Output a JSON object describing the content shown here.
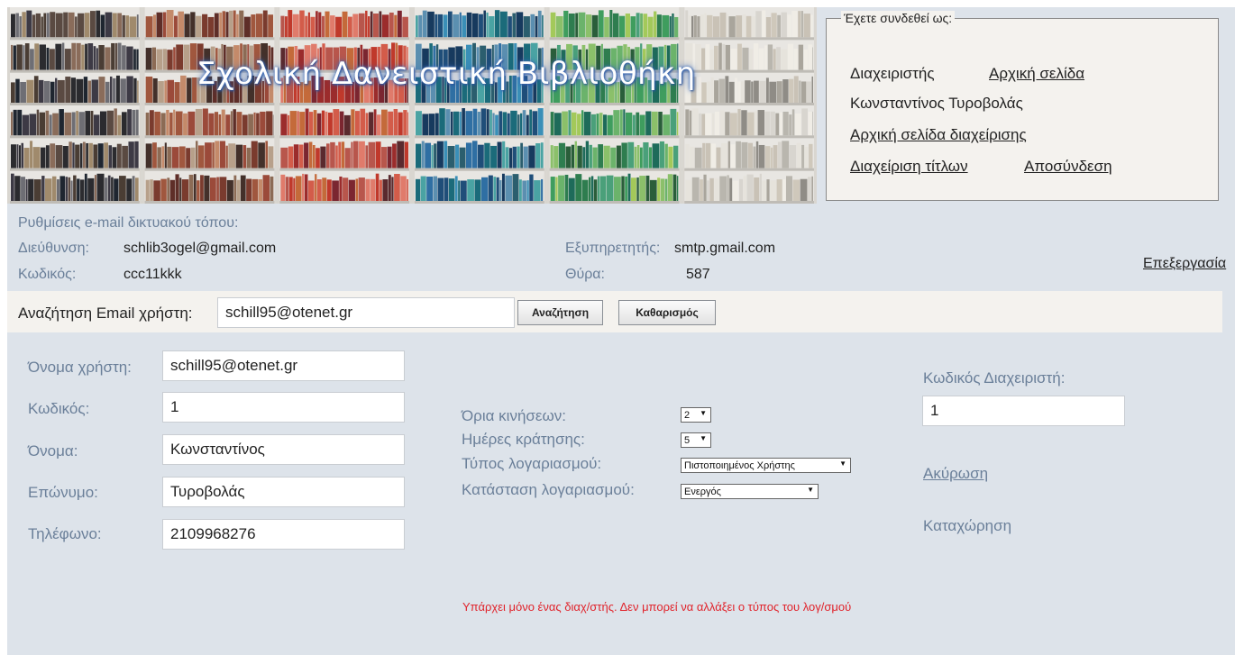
{
  "banner": {
    "title": "Σχολική Δανειστική Βιβλιοθήκη"
  },
  "login": {
    "legend": "Έχετε συνδεθεί ως:",
    "role": "Διαχειριστής",
    "home_link": "Αρχική σελίδα",
    "user_name": "Κωνσταντίνος Τυροβολάς",
    "admin_home_link": "Αρχική σελίδα διαχείρισης",
    "titles_link": "Διαχείριση τίτλων",
    "logout_link": "Αποσύνδεση"
  },
  "email_settings": {
    "heading": "Ρυθμίσεις e-mail δικτυακού τόπου:",
    "address_label": "Διεύθυνση:",
    "address_value": "schlib3ogel@gmail.com",
    "password_label": "Κωδικός:",
    "password_value": "ccc11kkk",
    "server_label": "Εξυπηρετητής:",
    "server_value": "smtp.gmail.com",
    "port_label": "Θύρα:",
    "port_value": "587",
    "edit_link": "Επεξεργασία"
  },
  "search": {
    "label": "Αναζήτηση Email χρήστη:",
    "value": "schill95@otenet.gr",
    "search_button": "Αναζήτηση",
    "clear_button": "Καθαρισμός"
  },
  "user_form": {
    "username_label": "Όνομα χρήστη:",
    "username_value": "schill95@otenet.gr",
    "password_label": "Κωδικός:",
    "password_value": "1",
    "firstname_label": "Όνομα:",
    "firstname_value": "Κωνσταντίνος",
    "lastname_label": "Επώνυμο:",
    "lastname_value": "Τυροβολάς",
    "phone_label": "Τηλέφωνο:",
    "phone_value": "2109968276"
  },
  "account": {
    "limits_label": "Όρια κινήσεων:",
    "limits_value": "2",
    "days_label": "Ημέρες κράτησης:",
    "days_value": "5",
    "type_label": "Τύπος λογαριασμού:",
    "type_value": "Πιστοποιημένος Χρήστης",
    "status_label": "Κατάσταση λογαριασμού:",
    "status_value": "Ενεργός"
  },
  "admin": {
    "code_label": "Κωδικός Διαχειριστή:",
    "code_value": "1",
    "cancel_link": "Ακύρωση",
    "submit_label": "Καταχώρηση"
  },
  "error_message": "Υπάρχει μόνο ένας διαχ/στής. Δεν μπορεί να αλλάξει ο τύπος του λογ/σμού",
  "colors": {
    "link": "#5779a3",
    "label": "#6a7f99",
    "error": "#e0232b",
    "page_bg": "#dde3ea",
    "panel_bg": "#f4f2ee"
  }
}
